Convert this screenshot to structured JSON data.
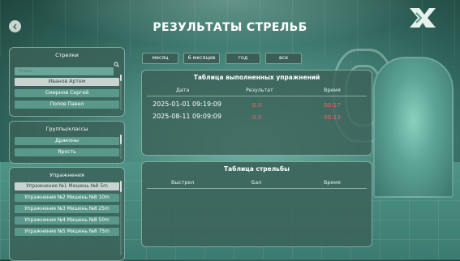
{
  "title": "РЕЗУЛЬТАТЫ СТРЕЛЬБ",
  "back_button": {
    "icon": "chevron-left-icon"
  },
  "logo": {
    "icon": "x-logo"
  },
  "period_tabs": [
    "месяц",
    "6 месяцев",
    "год",
    "все"
  ],
  "shooters": {
    "label": "Стрелки",
    "search_placeholder": "Поиск...",
    "items": [
      "Иванов Артем",
      "Смирнов Сергей",
      "Попов Павел"
    ],
    "selected": "Иванов Артем"
  },
  "groups": {
    "label": "Группы/классы",
    "items": [
      "Драконы",
      "Ярость"
    ]
  },
  "exercises": {
    "label": "Упражнения",
    "items": [
      "Упражнение №1 Мишень №8 5m",
      "Упражнение №2 Мишень №8 10m",
      "Упражнение №3 Мишень №8 25m",
      "Упражнение №4 Мишень №8 50m",
      "Упражнение №5 Мишень №8 75m"
    ],
    "selected": "Упражнение №1 Мишень №8 5m"
  },
  "exercises_table": {
    "title": "Таблица выполненных упражнений",
    "columns": [
      "Дата",
      "Результат",
      "Время"
    ],
    "rows": [
      {
        "date": "2025-01-01 09:19:09",
        "result": "0.0",
        "time": "00:17"
      },
      {
        "date": "2025-08-11 09:09:09",
        "result": "0.0",
        "time": "00:13"
      }
    ]
  },
  "shots_table": {
    "title": "Таблица стрельбы",
    "columns": [
      "Выстрел",
      "Бал",
      "Время"
    ]
  },
  "colors": {
    "accent": "#5a988c",
    "value_red": "#e96a5a",
    "panel": "#3a6058"
  }
}
